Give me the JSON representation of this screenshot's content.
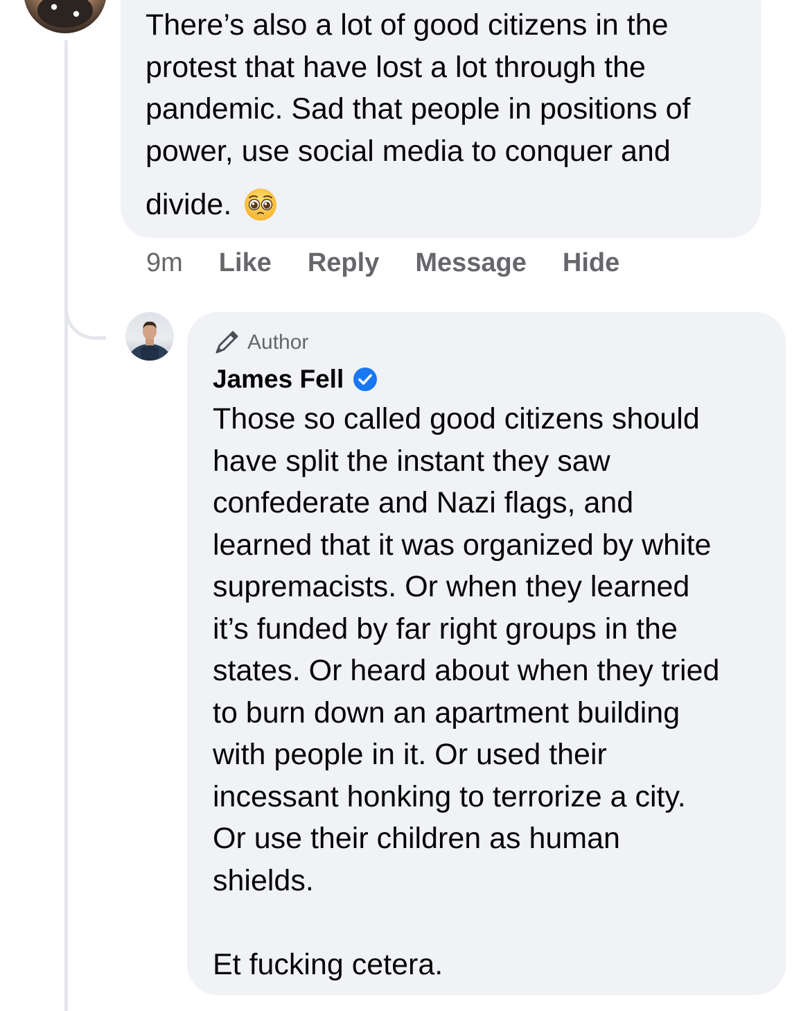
{
  "comment_parent": {
    "text": "There’s also a lot of good citizens in the\nprotest that have lost a lot through the\npandemic. Sad that people in positions of\npower, use social media to conquer and",
    "last_line": "divide.",
    "emoji": "pleading-face-emoji"
  },
  "actions": {
    "timestamp": "9m",
    "like": "Like",
    "reply": "Reply",
    "message": "Message",
    "hide": "Hide"
  },
  "reply_comment": {
    "badge": "Author",
    "author_name": "James Fell",
    "verified": true,
    "text": "Those so called good citizens should\nhave split the instant they saw\nconfederate and Nazi flags, and\nlearned that it was organized by white\nsupremacists. Or when they learned\nit’s funded by far right groups in the\nstates. Or heard about when they tried\nto burn down an apartment building\nwith people in it. Or used their\nincessant honking to terrorize a city.\nOr use their children as human\nshields.\n\nEt fucking cetera."
  },
  "colors": {
    "bubble_bg": "#f0f2f5",
    "secondary_text": "#65676b",
    "primary_text": "#050505",
    "verified_blue": "#1877f2",
    "thread_line": "#e4e6eb"
  }
}
